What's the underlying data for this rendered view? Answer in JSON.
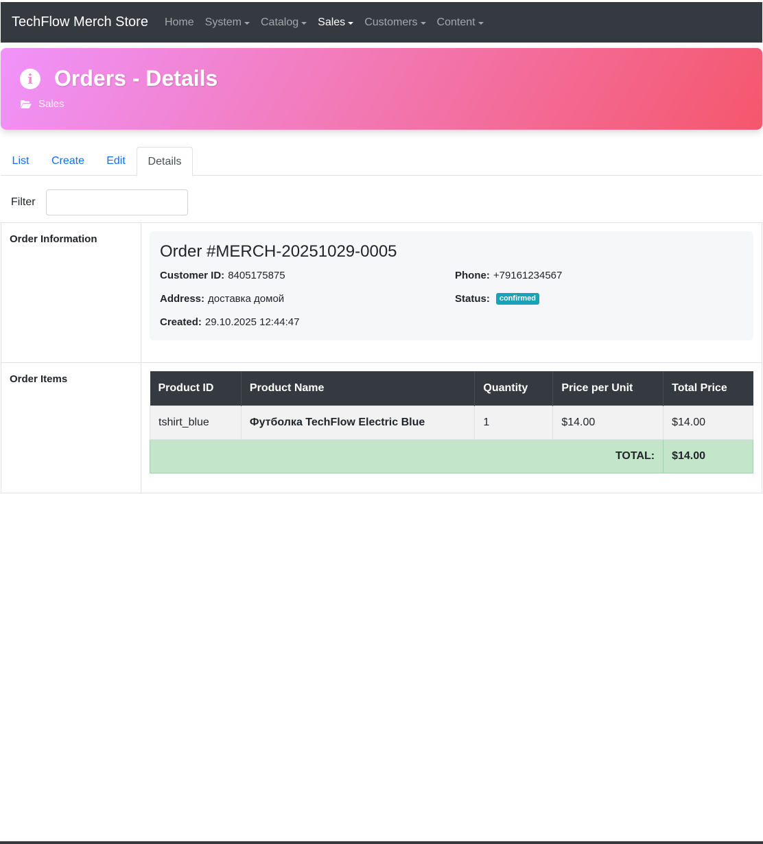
{
  "navbar": {
    "brand": "TechFlow Merch Store",
    "items": [
      {
        "label": "Home",
        "dropdown": false,
        "active": false
      },
      {
        "label": "System",
        "dropdown": true,
        "active": false
      },
      {
        "label": "Catalog",
        "dropdown": true,
        "active": false
      },
      {
        "label": "Sales",
        "dropdown": true,
        "active": true
      },
      {
        "label": "Customers",
        "dropdown": true,
        "active": false
      },
      {
        "label": "Content",
        "dropdown": true,
        "active": false
      }
    ]
  },
  "header": {
    "title": "Orders - Details",
    "breadcrumb": "Sales",
    "icon": "info-circle-icon",
    "gradient": [
      "#f093fb",
      "#f5576c"
    ]
  },
  "tabs": [
    {
      "label": "List",
      "active": false
    },
    {
      "label": "Create",
      "active": false
    },
    {
      "label": "Edit",
      "active": false
    },
    {
      "label": "Details",
      "active": true
    }
  ],
  "filter": {
    "label": "Filter",
    "value": "",
    "placeholder": ""
  },
  "order_information": {
    "section_label": "Order Information",
    "title": "Order #MERCH-20251029-0005",
    "customer_id_label": "Customer ID:",
    "customer_id": "8405175875",
    "phone_label": "Phone:",
    "phone": "+79161234567",
    "address_label": "Address:",
    "address": "доставка домой",
    "status_label": "Status:",
    "status": "confirmed",
    "status_color": "#17a2b8",
    "created_label": "Created:",
    "created": "29.10.2025 12:44:47"
  },
  "order_items": {
    "section_label": "Order Items",
    "columns": [
      "Product ID",
      "Product Name",
      "Quantity",
      "Price per Unit",
      "Total Price"
    ],
    "rows": [
      {
        "product_id": "tshirt_blue",
        "product_name": "Футболка TechFlow Electric Blue",
        "quantity": "1",
        "price_per_unit": "$14.00",
        "total_price": "$14.00"
      }
    ],
    "total_label": "TOTAL:",
    "total_value": "$14.00"
  },
  "colors": {
    "navbar_bg": "#343a40",
    "link": "#0d6efd",
    "total_row_bg": "#c3e6cb"
  }
}
